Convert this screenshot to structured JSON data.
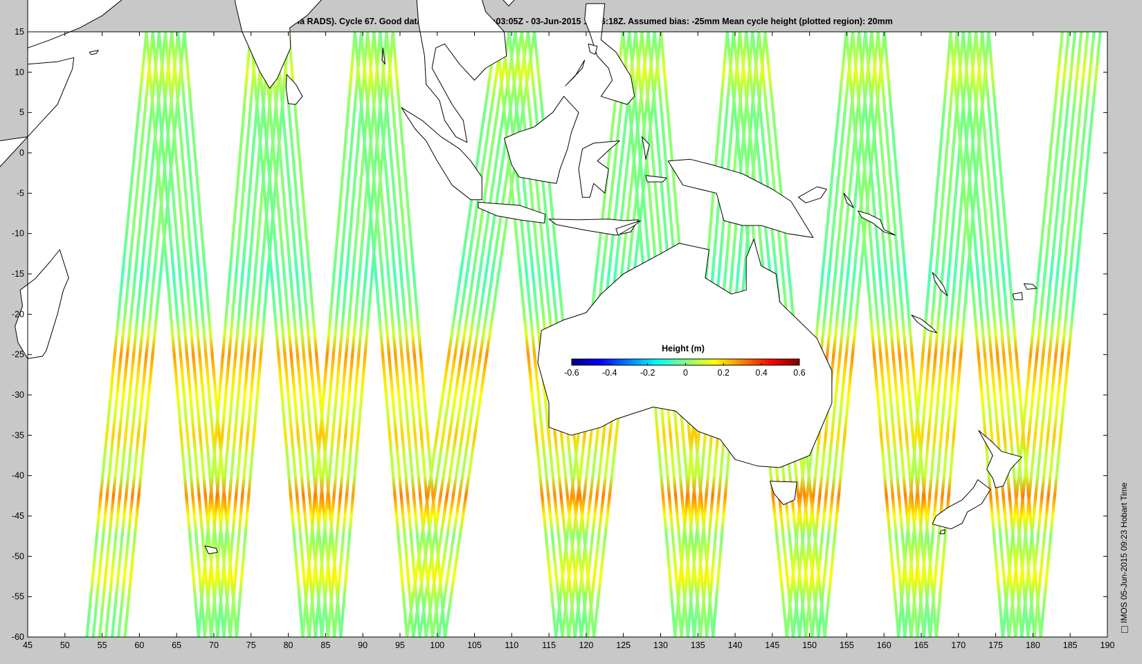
{
  "title": "CryoSat2 (via RADS). Cycle 67. Good data : 23-May-2015 10:03:05Z - 03-Jun-2015 17:16:18Z. Assumed bias: -25mm  Mean cycle height (plotted region): 20mm",
  "timestamp": "IMOS 05-Jun-2015 09:23 Hobart Time",
  "colorbar": {
    "title": "Height (m)",
    "range": [
      -0.6,
      0.6
    ],
    "ticks": [
      "-0.6",
      "-0.4",
      "-0.2",
      "0",
      "0.2",
      "0.4",
      "0.6"
    ],
    "colormap": "jet"
  },
  "chart_data": {
    "type": "scatter",
    "map_projection": "plate carree",
    "title": "CryoSat2 (via RADS). Cycle 67. Good data : 23-May-2015 10:03:05Z - 03-Jun-2015 17:16:18Z. Assumed bias: -25mm  Mean cycle height (plotted region): 20mm",
    "xlim": [
      45,
      190
    ],
    "ylim": [
      -60,
      15
    ],
    "x_ticks": [
      "45",
      "50",
      "55",
      "60",
      "65",
      "70",
      "75",
      "80",
      "85",
      "90",
      "95",
      "100",
      "105",
      "110",
      "115",
      "120",
      "125",
      "130",
      "135",
      "140",
      "145",
      "150",
      "155",
      "160",
      "165",
      "170",
      "175",
      "180",
      "185",
      "190"
    ],
    "y_ticks": [
      "15",
      "10",
      "5",
      "0",
      "-5",
      "-10",
      "-15",
      "-20",
      "-25",
      "-30",
      "-35",
      "-40",
      "-45",
      "-50",
      "-55",
      "-60"
    ],
    "color_variable": "Sea surface height anomaly (m)",
    "color_range": [
      -0.6,
      0.6
    ],
    "satellite_tracks": [
      {
        "apex_lon": 55.5,
        "apex_side": "bottom"
      },
      {
        "apex_lon": 63.5,
        "apex_side": "top"
      },
      {
        "apex_lon": 70.5,
        "apex_side": "bottom"
      },
      {
        "apex_lon": 77.5,
        "apex_side": "top"
      },
      {
        "apex_lon": 84.5,
        "apex_side": "bottom"
      },
      {
        "apex_lon": 91.5,
        "apex_side": "top"
      },
      {
        "apex_lon": 98.5,
        "apex_side": "bottom"
      },
      {
        "apex_lon": 110.5,
        "apex_side": "top"
      },
      {
        "apex_lon": 118.5,
        "apex_side": "bottom"
      },
      {
        "apex_lon": 127.5,
        "apex_side": "top"
      },
      {
        "apex_lon": 134.5,
        "apex_side": "bottom"
      },
      {
        "apex_lon": 141.5,
        "apex_side": "top"
      },
      {
        "apex_lon": 149.5,
        "apex_side": "bottom"
      },
      {
        "apex_lon": 157.5,
        "apex_side": "top"
      },
      {
        "apex_lon": 164.5,
        "apex_side": "bottom"
      },
      {
        "apex_lon": 171.5,
        "apex_side": "top"
      },
      {
        "apex_lon": 178.5,
        "apex_side": "bottom"
      },
      {
        "apex_lon": 186.5,
        "apex_side": "top"
      }
    ],
    "height_bands": [
      {
        "lat": 10,
        "value": 0.1
      },
      {
        "lat": -5,
        "value": 0.0
      },
      {
        "lat": -15,
        "value": -0.05
      },
      {
        "lat": -25,
        "value": 0.25
      },
      {
        "lat": -29,
        "value": 0.15
      },
      {
        "lat": -35,
        "value": 0.2
      },
      {
        "lat": -43,
        "value": 0.3
      },
      {
        "lat": -52,
        "value": 0.15
      }
    ],
    "landmasses": [
      "Australia",
      "New Guinea",
      "Borneo",
      "Sumatra",
      "Java",
      "Sulawesi",
      "Philippines",
      "India",
      "Sri Lanka",
      "Madagascar",
      "Arabian Peninsula",
      "Indochina",
      "New Zealand",
      "Tasmania",
      "New Caledonia"
    ],
    "grid": false
  }
}
